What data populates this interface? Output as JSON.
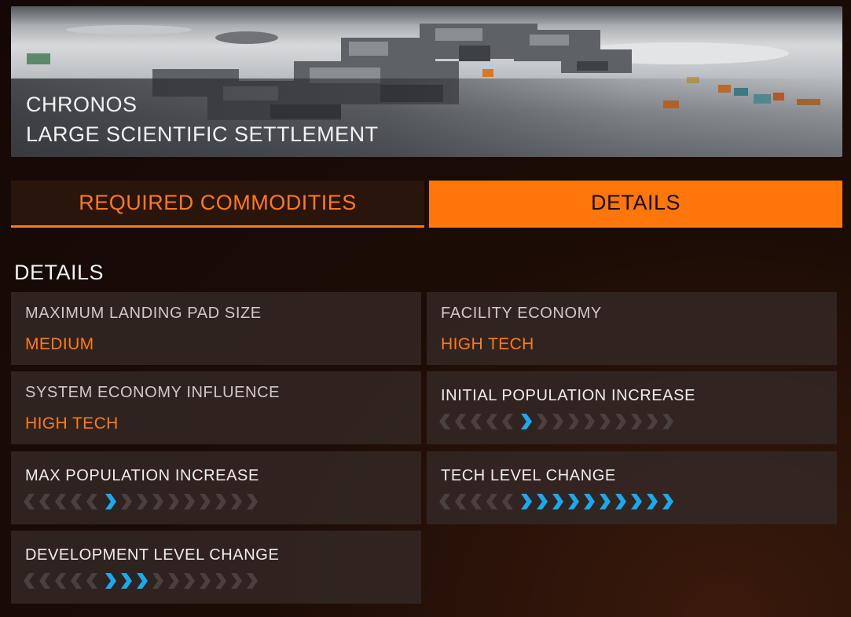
{
  "banner": {
    "name": "CHRONOS",
    "type": "LARGE SCIENTIFIC SETTLEMENT"
  },
  "tabs": [
    {
      "label": "REQUIRED COMMODITIES",
      "selected": false
    },
    {
      "label": "DETAILS",
      "selected": true
    }
  ],
  "section_title": "DETAILS",
  "details": {
    "landing_pad": {
      "label": "MAXIMUM LANDING PAD SIZE",
      "value": "MEDIUM"
    },
    "facility_economy": {
      "label": "FACILITY ECONOMY",
      "value": "HIGH TECH"
    },
    "system_economy": {
      "label": "SYSTEM ECONOMY INFLUENCE",
      "value": "HIGH TECH"
    },
    "initial_population": {
      "label": "INITIAL POPULATION INCREASE",
      "scale": {
        "negative": 5,
        "positive": 10,
        "level": 1
      }
    },
    "max_population": {
      "label": "MAX POPULATION INCREASE",
      "scale": {
        "negative": 5,
        "positive": 10,
        "level": 1
      }
    },
    "tech_level": {
      "label": "TECH LEVEL CHANGE",
      "scale": {
        "negative": 5,
        "positive": 10,
        "level": 10
      }
    },
    "development_level": {
      "label": "DEVELOPMENT LEVEL CHANGE",
      "scale": {
        "negative": 5,
        "positive": 10,
        "level": 3
      }
    }
  },
  "colors": {
    "accent": "#ff7a1a",
    "active_chevron": "#19a9f0",
    "inactive_chevron": "#4a403d"
  }
}
